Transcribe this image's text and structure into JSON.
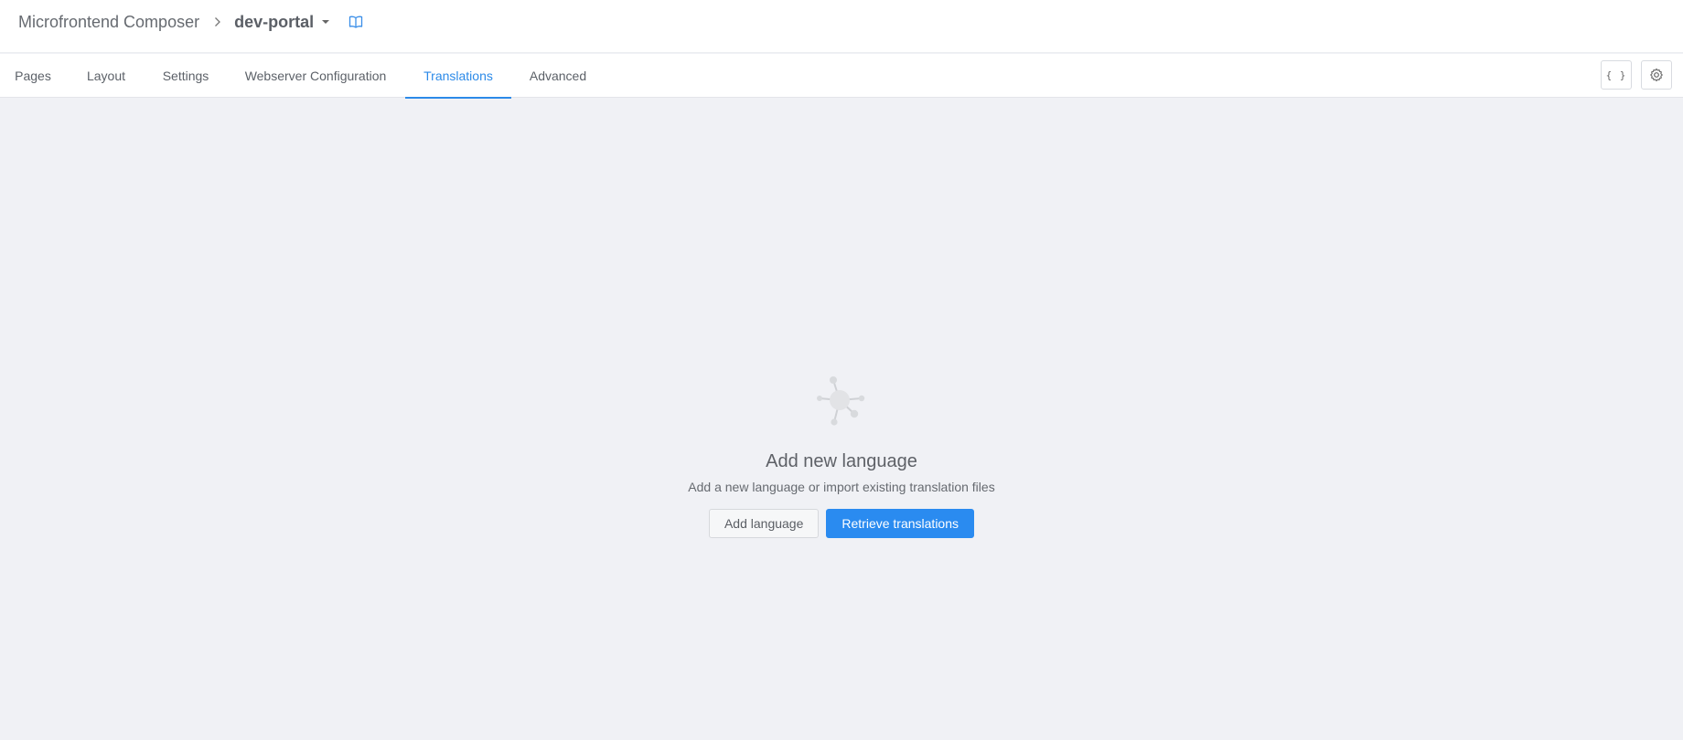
{
  "header": {
    "app_name": "Microfrontend Composer",
    "project": "dev-portal",
    "icons": [
      "chevron-right-icon",
      "caret-down-icon",
      "book-icon"
    ]
  },
  "tabs": [
    {
      "label": "Pages",
      "active": false
    },
    {
      "label": "Layout",
      "active": false
    },
    {
      "label": "Settings",
      "active": false
    },
    {
      "label": "Webserver Configuration",
      "active": false
    },
    {
      "label": "Translations",
      "active": true
    },
    {
      "label": "Advanced",
      "active": false
    }
  ],
  "toolbar": {
    "json_icon": "{ }",
    "settings_icon": "gear-icon"
  },
  "empty_state": {
    "icon": "network-nodes-icon",
    "title": "Add new language",
    "subtitle": "Add a new language or import existing translation files",
    "add_button": "Add language",
    "retrieve_button": "Retrieve translations"
  },
  "colors": {
    "accent": "#2c8ae8",
    "primary_button": "#2a8bf0",
    "background": "#f0f1f5"
  }
}
